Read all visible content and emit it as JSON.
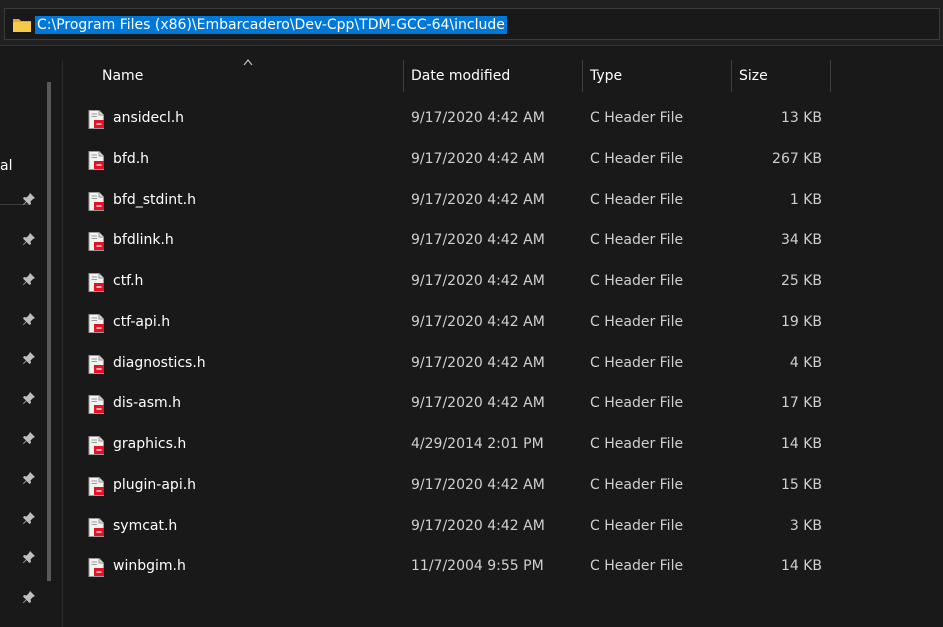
{
  "address": {
    "path": "C:\\Program Files (x86)\\Embarcadero\\Dev-Cpp\\TDM-GCC-64\\include"
  },
  "nav": {
    "label": "al"
  },
  "columns": {
    "name": "Name",
    "date": "Date modified",
    "type": "Type",
    "size": "Size"
  },
  "files": [
    {
      "name": "ansidecl.h",
      "date": "9/17/2020 4:42 AM",
      "type": "C Header File",
      "size": "13 KB"
    },
    {
      "name": "bfd.h",
      "date": "9/17/2020 4:42 AM",
      "type": "C Header File",
      "size": "267 KB"
    },
    {
      "name": "bfd_stdint.h",
      "date": "9/17/2020 4:42 AM",
      "type": "C Header File",
      "size": "1 KB"
    },
    {
      "name": "bfdlink.h",
      "date": "9/17/2020 4:42 AM",
      "type": "C Header File",
      "size": "34 KB"
    },
    {
      "name": "ctf.h",
      "date": "9/17/2020 4:42 AM",
      "type": "C Header File",
      "size": "25 KB"
    },
    {
      "name": "ctf-api.h",
      "date": "9/17/2020 4:42 AM",
      "type": "C Header File",
      "size": "19 KB"
    },
    {
      "name": "diagnostics.h",
      "date": "9/17/2020 4:42 AM",
      "type": "C Header File",
      "size": "4 KB"
    },
    {
      "name": "dis-asm.h",
      "date": "9/17/2020 4:42 AM",
      "type": "C Header File",
      "size": "17 KB"
    },
    {
      "name": "graphics.h",
      "date": "4/29/2014 2:01 PM",
      "type": "C Header File",
      "size": "14 KB"
    },
    {
      "name": "plugin-api.h",
      "date": "9/17/2020 4:42 AM",
      "type": "C Header File",
      "size": "15 KB"
    },
    {
      "name": "symcat.h",
      "date": "9/17/2020 4:42 AM",
      "type": "C Header File",
      "size": "3 KB"
    },
    {
      "name": "winbgim.h",
      "date": "11/7/2004 9:55 PM",
      "type": "C Header File",
      "size": "14 KB"
    }
  ],
  "colors": {
    "background": "#191919",
    "selection": "#0078d7",
    "folder": "#f7c948",
    "fileBadge": "#e81123"
  },
  "icons": {
    "address": "folder-icon",
    "sort": "sort-ascending-icon",
    "pin": "pin-icon",
    "file": "c-header-file-icon"
  }
}
